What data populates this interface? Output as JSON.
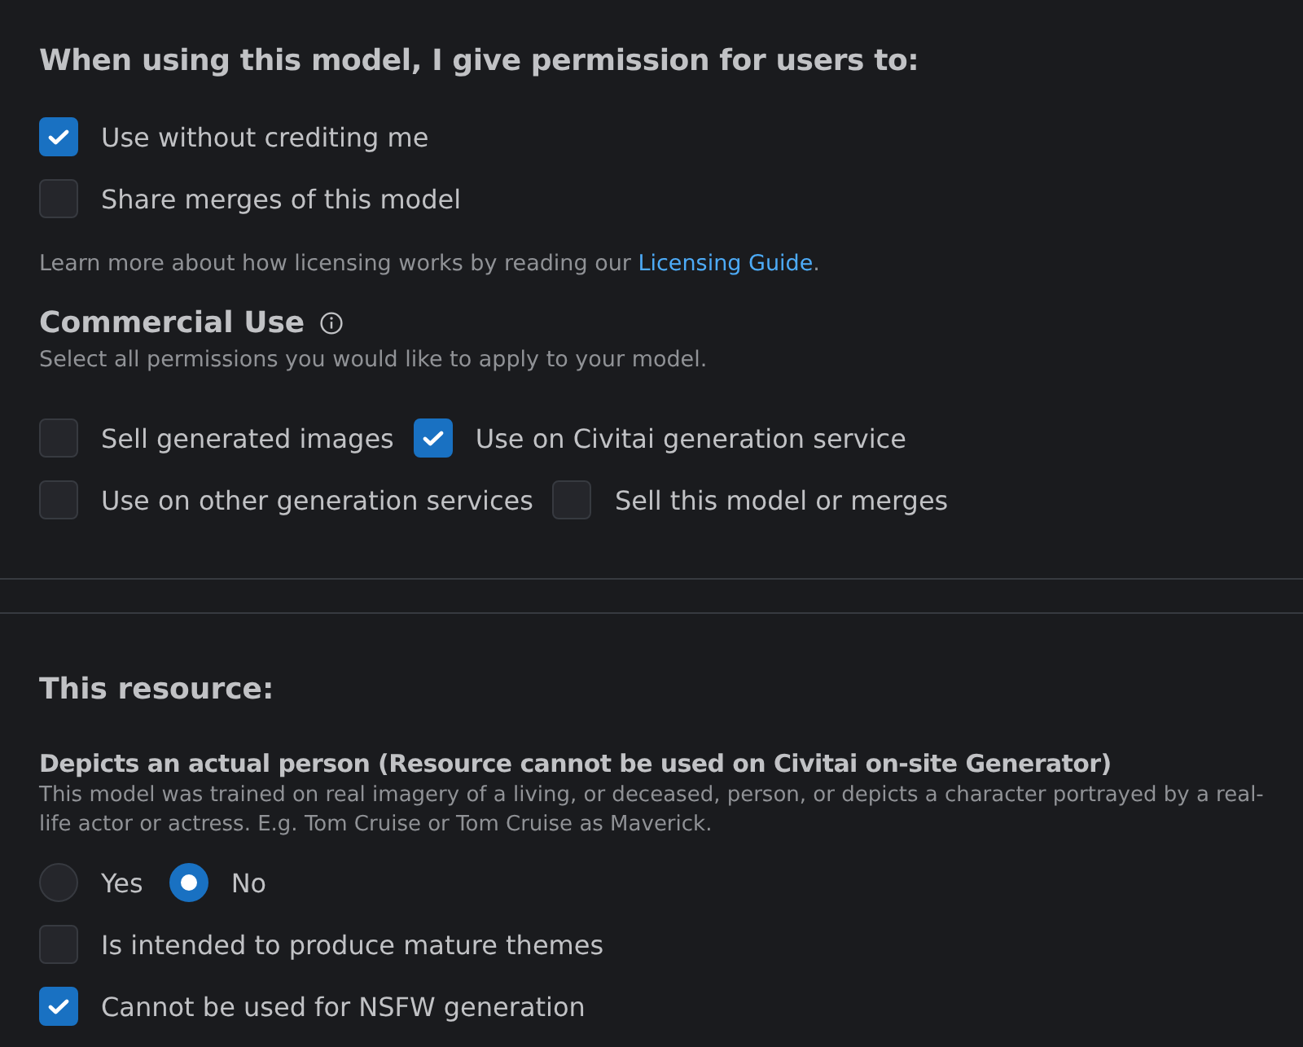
{
  "permissions": {
    "title": "When using this model, I give permission for users to:",
    "options": [
      {
        "label": "Use without crediting me",
        "checked": true
      },
      {
        "label": "Share merges of this model",
        "checked": false
      }
    ],
    "note": "Learn more about how licensing works by reading our ",
    "note_link": "Licensing Guide",
    "note_end": "."
  },
  "commercial": {
    "title": "Commercial Use",
    "subtitle": "Select all permissions you would like to apply to your model.",
    "options": [
      {
        "label": "Sell generated images",
        "checked": false
      },
      {
        "label": "Use on Civitai generation service",
        "checked": true
      },
      {
        "label": "Use on other generation services",
        "checked": false
      },
      {
        "label": "Sell this model or merges",
        "checked": false
      }
    ]
  },
  "resource": {
    "title": "This resource:",
    "question": "Depicts an actual person (Resource cannot be used on Civitai on-site Generator)",
    "description": "This model was trained on real imagery of a living, or deceased, person, or depicts a character portrayed by a real-life actor or actress. E.g. Tom Cruise or Tom Cruise as Maverick.",
    "radios": [
      {
        "label": "Yes",
        "selected": false
      },
      {
        "label": "No",
        "selected": true
      }
    ],
    "options": [
      {
        "label": "Is intended to produce mature themes",
        "checked": false
      },
      {
        "label": "Cannot be used for NSFW generation",
        "checked": true
      }
    ]
  }
}
